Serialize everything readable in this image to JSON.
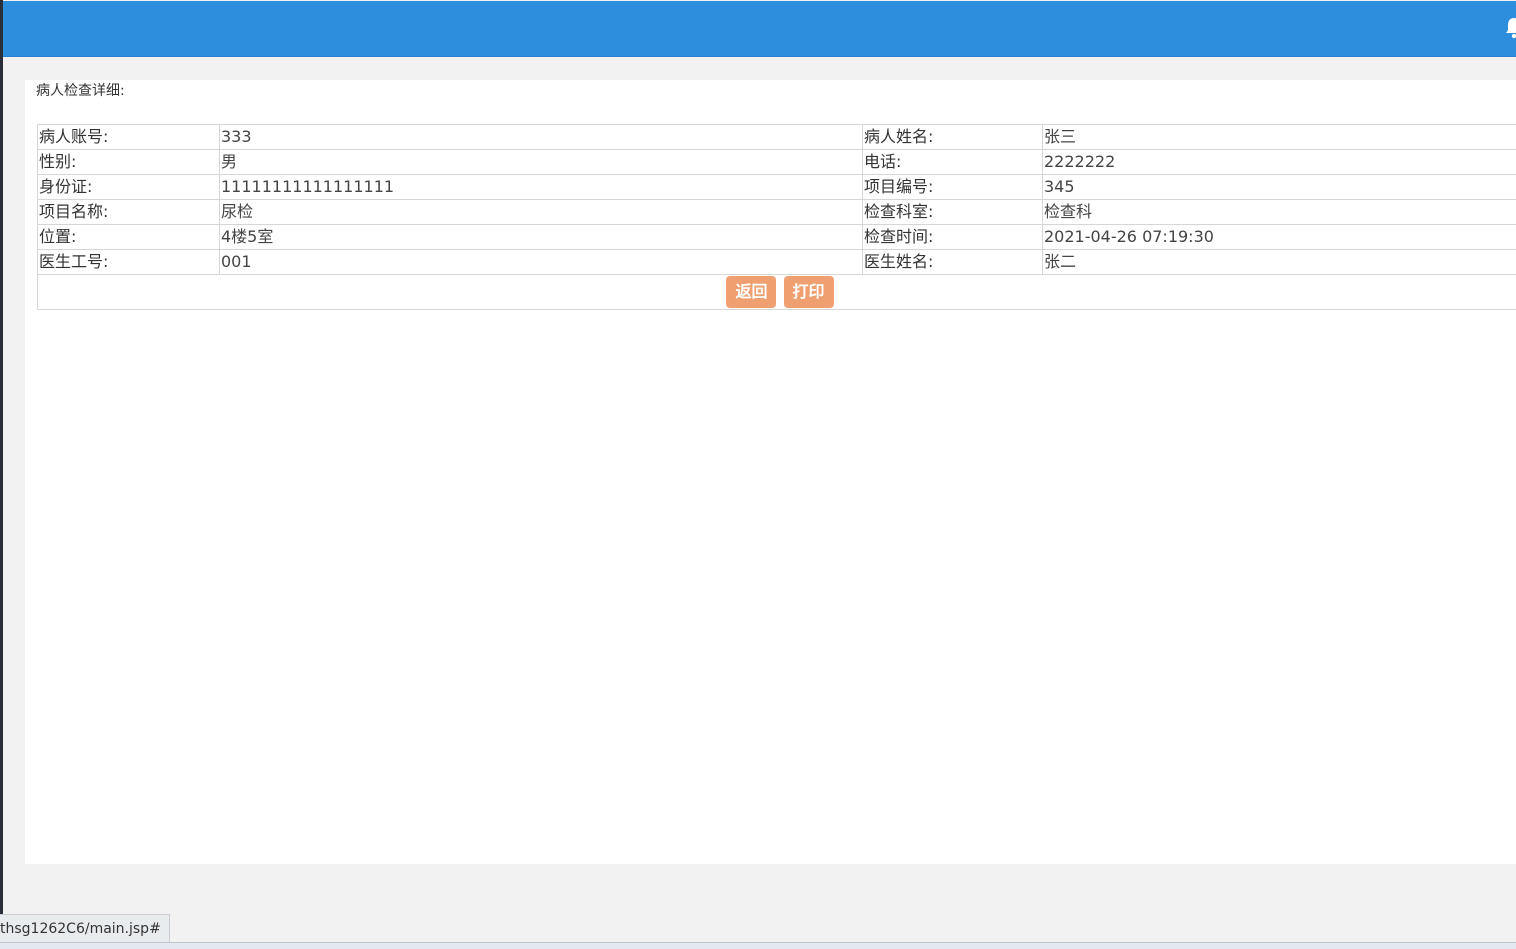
{
  "panel": {
    "title": "病人检查详细:"
  },
  "details": {
    "rows": [
      {
        "l1": "病人账号:",
        "v1": "333",
        "l2": "病人姓名:",
        "v2": "张三"
      },
      {
        "l1": "性别:",
        "v1": "男",
        "l2": "电话:",
        "v2": "2222222"
      },
      {
        "l1": "身份证:",
        "v1": "11111111111111111",
        "l2": "项目编号:",
        "v2": "345"
      },
      {
        "l1": "项目名称:",
        "v1": "尿检",
        "l2": "检查科室:",
        "v2": "检查科"
      },
      {
        "l1": "位置:",
        "v1": "4楼5室",
        "l2": "检查时间:",
        "v2": "2021-04-26 07:19:30"
      },
      {
        "l1": "医生工号:",
        "v1": "001",
        "l2": "医生姓名:",
        "v2": "张二"
      }
    ]
  },
  "actions": {
    "back_label": "返回",
    "print_label": "打印"
  },
  "status": {
    "url": "thsg1262C6/main.jsp#"
  },
  "colors": {
    "topbar": "#2e8ede",
    "button": "#f0a070"
  },
  "icons": {
    "topbar_right": "bell-icon"
  }
}
